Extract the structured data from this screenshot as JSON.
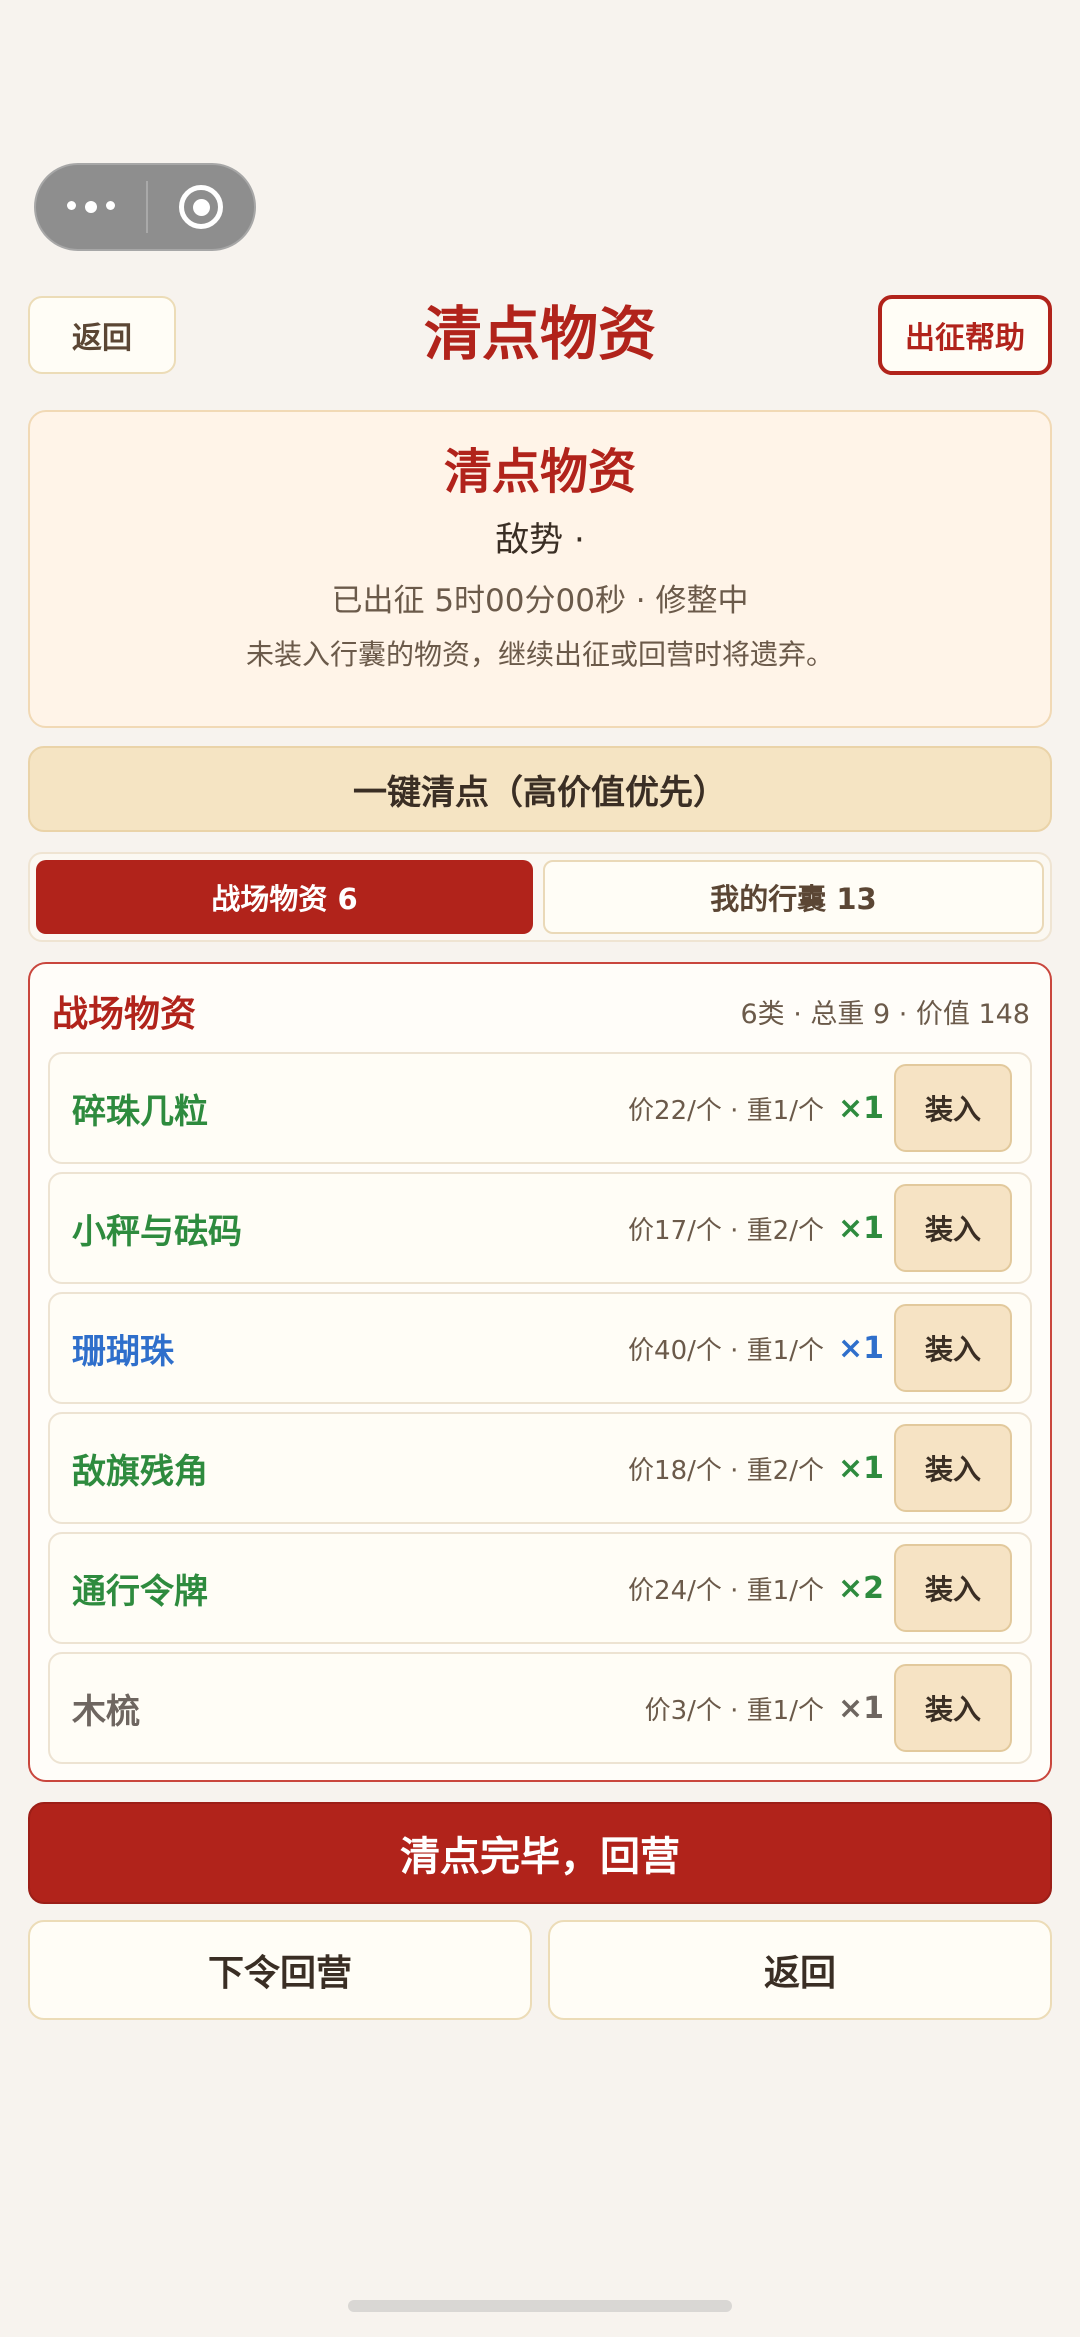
{
  "header": {
    "back_label": "返回",
    "title": "清点物资",
    "help_label": "出征帮助"
  },
  "info": {
    "title": "清点物资",
    "enemy": "敌势 ·",
    "status": "已出征 5时00分00秒 · 修整中",
    "hint": "未装入行囊的物资，继续出征或回营时将遗弃。"
  },
  "auto_button": "一键清点（高价值优先）",
  "tabs": [
    {
      "label": "战场物资 6"
    },
    {
      "label": "我的行囊 13"
    }
  ],
  "panel": {
    "title": "战场物资",
    "summary": "6类 · 总重 9 · 价值 148",
    "put_label": "装入",
    "items": [
      {
        "name": "碎珠几粒",
        "meta": "价22/个 · 重1/个",
        "qty": "×1",
        "color": "#2e8b3e"
      },
      {
        "name": "小秤与砝码",
        "meta": "价17/个 · 重2/个",
        "qty": "×1",
        "color": "#2e8b3e"
      },
      {
        "name": "珊瑚珠",
        "meta": "价40/个 · 重1/个",
        "qty": "×1",
        "color": "#2f6fcb"
      },
      {
        "name": "敌旗残角",
        "meta": "价18/个 · 重2/个",
        "qty": "×1",
        "color": "#2e8b3e"
      },
      {
        "name": "通行令牌",
        "meta": "价24/个 · 重1/个",
        "qty": "×2",
        "color": "#2e8b3e"
      },
      {
        "name": "木梳",
        "meta": "价3/个 · 重1/个",
        "qty": "×1",
        "color": "#6e6660"
      }
    ]
  },
  "footer": {
    "done_label": "清点完毕，回营",
    "order_return_label": "下令回营",
    "back_label": "返回"
  },
  "colors": {
    "accent": "#b1231b",
    "common": "#2e8b3e",
    "rare": "#2f6fcb",
    "junk": "#6e6660"
  }
}
